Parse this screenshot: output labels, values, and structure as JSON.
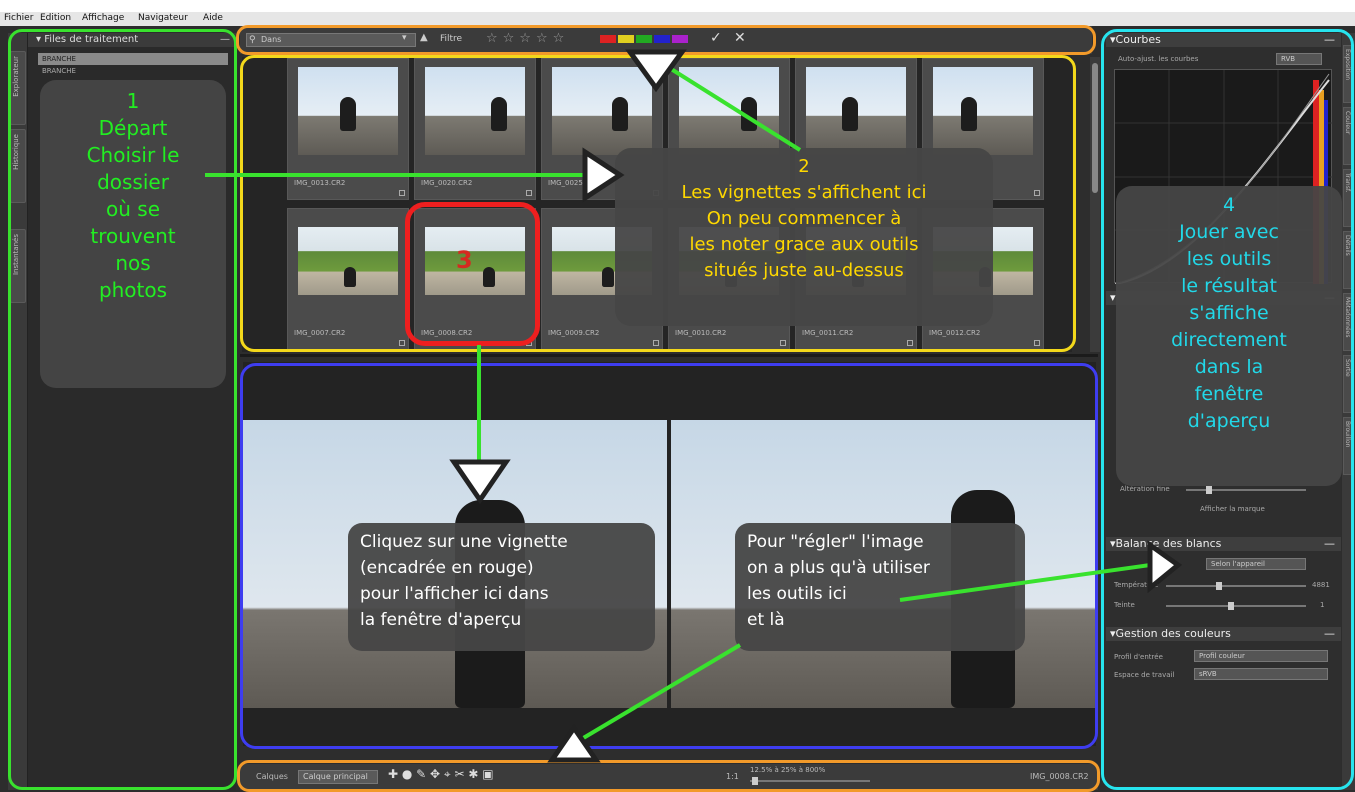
{
  "menu": [
    "Fichier",
    "Edition",
    "Affichage",
    "Navigateur",
    "Aide"
  ],
  "left_tabs": [
    "Explorateur",
    "Historique",
    "Instantanés"
  ],
  "left_panel": {
    "title": "Files de traitement",
    "item1": "BRANCHE",
    "item2": "BRANCHE"
  },
  "top_toolbar": {
    "filter_value": "Dans",
    "filter_label": "Filtre",
    "stars": "☆☆☆☆☆"
  },
  "thumbnails": [
    {
      "caption": "IMG_0013.CR2",
      "kind": "portrait"
    },
    {
      "caption": "IMG_0020.CR2",
      "kind": "portrait"
    },
    {
      "caption": "IMG_0025.CR2",
      "kind": "portrait"
    },
    {
      "caption": "",
      "kind": "portrait"
    },
    {
      "caption": "",
      "kind": "portrait"
    },
    {
      "caption": "",
      "kind": "portrait"
    },
    {
      "caption": "IMG_0007.CR2",
      "kind": "land"
    },
    {
      "caption": "IMG_0008.CR2",
      "kind": "land"
    },
    {
      "caption": "IMG_0009.CR2",
      "kind": "land"
    },
    {
      "caption": "IMG_0010.CR2",
      "kind": "land"
    },
    {
      "caption": "IMG_0011.CR2",
      "kind": "land"
    },
    {
      "caption": "IMG_0012.CR2",
      "kind": "land"
    }
  ],
  "callouts": {
    "c1_num": "1",
    "c1": "Départ\nChoisir le\ndossier\noù se\ntrouvent\nnos\nphotos",
    "c2_num": "2",
    "c2": "Les vignettes s'affichent ici\nOn peu commencer à\nles noter grace aux outils\nsitués juste au-dessus",
    "c3_num": "3",
    "c3": "Cliquez sur une vignette\n(encadrée en rouge)\npour l'afficher ici dans\nla fenêtre d'aperçu",
    "c4": "Pour \"régler\" l'image\non a plus qu'à utiliser\nles outils ici\net là",
    "c5_num": "4",
    "c5": "Jouer avec\nles outils\nle résultat\ns'affiche\ndirectement\ndans la\nfenêtre\nd'aperçu"
  },
  "right_panel": {
    "curves_title": "Courbes",
    "curves_auto": "Auto-ajust. les courbes",
    "curves_mode": "RVB",
    "wb_title": "Balance des blancs",
    "wb_method": "Selon l'appareil",
    "wb_temp_label": "Température",
    "wb_temp_value": "4881",
    "wb_tint_label": "Teinte",
    "wb_tint_value": "1",
    "color_title": "Gestion des couleurs",
    "color_in_label": "Profil d'entrée",
    "color_in_value": "Profil couleur",
    "color_work_label": "Espace de travail",
    "color_work_value": "sRVB",
    "show_label": "Afficher la marque",
    "alt_label": "Altération fine"
  },
  "right_tabs": [
    "Exposition",
    "Couleur",
    "Transf.",
    "Détails",
    "Métadonnées",
    "Sortie",
    "Brouillon"
  ],
  "bottom_toolbar": {
    "label1": "Calques",
    "layer": "Calque principal",
    "zoom": "1:1",
    "zoom_range": "12.5% à 25% à 800%",
    "filename": "IMG_0008.CR2"
  },
  "colors": {
    "green": "#39e22e",
    "orange": "#f29a2a",
    "yellow": "#f3d81b",
    "red": "#ee1f1f",
    "blue": "#3e3df0",
    "cyan": "#27e4ee"
  }
}
